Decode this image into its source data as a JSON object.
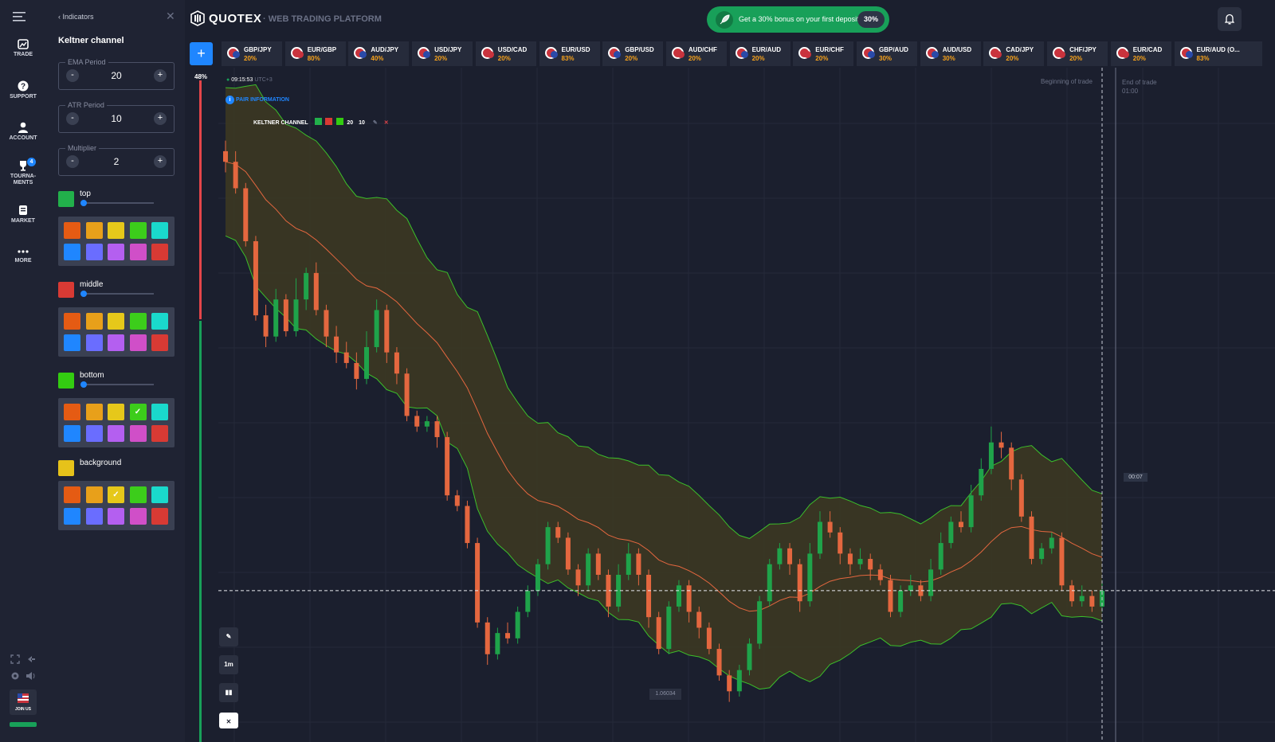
{
  "nav": {
    "items": [
      {
        "label": "TRADE"
      },
      {
        "label": "SUPPORT"
      },
      {
        "label": "ACCOUNT"
      },
      {
        "label": "TOURNA-"
      },
      {
        "label": "MENTS"
      },
      {
        "label": "MARKET"
      },
      {
        "label": "MORE"
      }
    ],
    "tournaments_badge": "4",
    "join_label": "JOIN US"
  },
  "panel": {
    "back_label": "Indicators",
    "close_glyph": "✕",
    "title": "Keltner channel",
    "fields": [
      {
        "label": "EMA Period",
        "value": "20"
      },
      {
        "label": "ATR Period",
        "value": "10"
      },
      {
        "label": "Multiplier",
        "value": "2"
      }
    ],
    "minus": "-",
    "plus": "+",
    "colors": [
      {
        "name": "top",
        "swatch": "#22b04b",
        "selected": -1
      },
      {
        "name": "middle",
        "swatch": "#d83a34",
        "selected": -1
      },
      {
        "name": "bottom",
        "swatch": "#33cc11",
        "selected": 3
      },
      {
        "name": "background",
        "swatch": "#e6c21a",
        "selected": 2
      }
    ],
    "palette": [
      "#e55b13",
      "#e8a01a",
      "#e6c81a",
      "#3ccd1b",
      "#1ad9cc",
      "#1f86ff",
      "#6a6dff",
      "#b45ff0",
      "#d04fc8",
      "#d83a34"
    ],
    "check": "✓"
  },
  "header": {
    "brand": "QUOTEX",
    "platform": "WEB TRADING PLATFORM",
    "bonus_text": "Get a 30% bonus on your first deposit",
    "bonus_pct": "30%"
  },
  "tabs": [
    {
      "pair": "GBP/JPY",
      "pct": "20%"
    },
    {
      "pair": "EUR/GBP",
      "pct": "80%"
    },
    {
      "pair": "AUD/JPY",
      "pct": "40%"
    },
    {
      "pair": "USD/JPY",
      "pct": "20%"
    },
    {
      "pair": "USD/CAD",
      "pct": "20%"
    },
    {
      "pair": "EUR/USD",
      "pct": "83%"
    },
    {
      "pair": "GBP/USD",
      "pct": "20%"
    },
    {
      "pair": "AUD/CHF",
      "pct": "20%"
    },
    {
      "pair": "EUR/AUD",
      "pct": "20%"
    },
    {
      "pair": "EUR/CHF",
      "pct": "20%"
    },
    {
      "pair": "GBP/AUD",
      "pct": "30%"
    },
    {
      "pair": "AUD/USD",
      "pct": "30%"
    },
    {
      "pair": "CAD/JPY",
      "pct": "20%"
    },
    {
      "pair": "CHF/JPY",
      "pct": "20%"
    },
    {
      "pair": "EUR/CAD",
      "pct": "20%"
    },
    {
      "pair": "EUR/AUD (O...",
      "pct": "83%"
    }
  ],
  "chart": {
    "sentiment_pct": "48%",
    "time": "09:15:53",
    "timezone": "UTC+3",
    "pair_info": "PAIR INFORMATION",
    "indicator_name": "KELTNER CHANNEL",
    "indicator_params": [
      "20",
      "10"
    ],
    "beginning_label": "Beginning of trade",
    "end_label": "End of trade",
    "end_time": "01:00",
    "price_tag": "00:07",
    "low_tag": "1.06034",
    "timeframe": "1m",
    "colors": {
      "up": "#1fa34a",
      "down": "#e4673f",
      "band": "#3cbf2a",
      "mid": "#e4673f",
      "fill": "#3d3a21"
    }
  },
  "chart_data": {
    "type": "candlestick",
    "candles": [
      [
        0.9,
        0.88,
        0.92,
        0.86
      ],
      [
        0.88,
        0.83,
        0.9,
        0.82
      ],
      [
        0.83,
        0.73,
        0.84,
        0.72
      ],
      [
        0.73,
        0.59,
        0.74,
        0.58
      ],
      [
        0.59,
        0.55,
        0.61,
        0.53
      ],
      [
        0.55,
        0.62,
        0.64,
        0.54
      ],
      [
        0.62,
        0.56,
        0.63,
        0.55
      ],
      [
        0.56,
        0.62,
        0.66,
        0.55
      ],
      [
        0.62,
        0.67,
        0.68,
        0.6
      ],
      [
        0.67,
        0.6,
        0.69,
        0.59
      ],
      [
        0.6,
        0.55,
        0.61,
        0.53
      ],
      [
        0.55,
        0.52,
        0.57,
        0.5
      ],
      [
        0.52,
        0.5,
        0.54,
        0.49
      ],
      [
        0.5,
        0.47,
        0.52,
        0.45
      ],
      [
        0.47,
        0.53,
        0.56,
        0.46
      ],
      [
        0.53,
        0.6,
        0.62,
        0.52
      ],
      [
        0.6,
        0.52,
        0.61,
        0.5
      ],
      [
        0.52,
        0.48,
        0.53,
        0.46
      ],
      [
        0.48,
        0.4,
        0.49,
        0.39
      ],
      [
        0.4,
        0.38,
        0.41,
        0.37
      ],
      [
        0.38,
        0.39,
        0.4,
        0.37
      ],
      [
        0.39,
        0.36,
        0.4,
        0.34
      ],
      [
        0.36,
        0.25,
        0.37,
        0.24
      ],
      [
        0.25,
        0.23,
        0.26,
        0.22
      ],
      [
        0.23,
        0.16,
        0.24,
        0.15
      ],
      [
        0.16,
        0.01,
        0.17,
        0.0
      ],
      [
        0.01,
        -0.05,
        0.02,
        -0.07
      ],
      [
        -0.05,
        -0.01,
        0.0,
        -0.06
      ],
      [
        -0.01,
        -0.02,
        0.01,
        -0.03
      ],
      [
        -0.02,
        0.03,
        0.04,
        -0.03
      ],
      [
        0.03,
        0.07,
        0.08,
        0.02
      ],
      [
        0.07,
        0.12,
        0.13,
        0.06
      ],
      [
        0.12,
        0.19,
        0.2,
        0.11
      ],
      [
        0.19,
        0.17,
        0.2,
        0.16
      ],
      [
        0.17,
        0.11,
        0.18,
        0.1
      ],
      [
        0.11,
        0.08,
        0.12,
        0.06
      ],
      [
        0.08,
        0.14,
        0.15,
        0.07
      ],
      [
        0.14,
        0.1,
        0.15,
        0.09
      ],
      [
        0.1,
        0.04,
        0.11,
        0.02
      ],
      [
        0.04,
        0.1,
        0.12,
        0.03
      ],
      [
        0.1,
        0.14,
        0.16,
        0.09
      ],
      [
        0.14,
        0.1,
        0.15,
        0.08
      ],
      [
        0.1,
        0.02,
        0.11,
        0.0
      ],
      [
        0.02,
        -0.04,
        0.03,
        -0.05
      ],
      [
        -0.04,
        0.04,
        0.05,
        -0.05
      ],
      [
        0.04,
        0.08,
        0.09,
        0.03
      ],
      [
        0.08,
        0.03,
        0.09,
        0.01
      ],
      [
        0.03,
        0.0,
        0.04,
        -0.02
      ],
      [
        0.0,
        -0.04,
        0.01,
        -0.05
      ],
      [
        -0.04,
        -0.09,
        -0.03,
        -0.1
      ],
      [
        -0.09,
        -0.12,
        -0.08,
        -0.14
      ],
      [
        -0.12,
        -0.08,
        -0.07,
        -0.13
      ],
      [
        -0.08,
        -0.03,
        -0.02,
        -0.09
      ],
      [
        -0.03,
        0.05,
        0.06,
        -0.04
      ],
      [
        0.05,
        0.12,
        0.13,
        0.04
      ],
      [
        0.12,
        0.15,
        0.16,
        0.11
      ],
      [
        0.15,
        0.12,
        0.16,
        0.1
      ],
      [
        0.12,
        0.05,
        0.13,
        0.03
      ],
      [
        0.05,
        0.14,
        0.16,
        0.04
      ],
      [
        0.14,
        0.2,
        0.22,
        0.13
      ],
      [
        0.2,
        0.18,
        0.22,
        0.17
      ],
      [
        0.18,
        0.14,
        0.19,
        0.12
      ],
      [
        0.14,
        0.12,
        0.15,
        0.1
      ],
      [
        0.12,
        0.13,
        0.15,
        0.11
      ],
      [
        0.13,
        0.11,
        0.14,
        0.09
      ],
      [
        0.11,
        0.09,
        0.12,
        0.08
      ],
      [
        0.09,
        0.03,
        0.1,
        0.02
      ],
      [
        0.03,
        0.07,
        0.08,
        0.02
      ],
      [
        0.07,
        0.08,
        0.1,
        0.06
      ],
      [
        0.08,
        0.06,
        0.09,
        0.05
      ],
      [
        0.06,
        0.11,
        0.13,
        0.05
      ],
      [
        0.11,
        0.16,
        0.18,
        0.1
      ],
      [
        0.16,
        0.2,
        0.21,
        0.15
      ],
      [
        0.2,
        0.19,
        0.22,
        0.18
      ],
      [
        0.19,
        0.25,
        0.27,
        0.18
      ],
      [
        0.25,
        0.3,
        0.32,
        0.24
      ],
      [
        0.3,
        0.35,
        0.38,
        0.29
      ],
      [
        0.35,
        0.34,
        0.37,
        0.32
      ],
      [
        0.34,
        0.28,
        0.35,
        0.26
      ],
      [
        0.28,
        0.21,
        0.29,
        0.2
      ],
      [
        0.21,
        0.13,
        0.22,
        0.12
      ],
      [
        0.13,
        0.15,
        0.16,
        0.12
      ],
      [
        0.15,
        0.17,
        0.18,
        0.14
      ],
      [
        0.17,
        0.08,
        0.18,
        0.07
      ],
      [
        0.08,
        0.05,
        0.09,
        0.04
      ],
      [
        0.05,
        0.06,
        0.08,
        0.04
      ],
      [
        0.06,
        0.04,
        0.07,
        0.03
      ],
      [
        0.04,
        0.07,
        0.09,
        0.03
      ]
    ]
  }
}
